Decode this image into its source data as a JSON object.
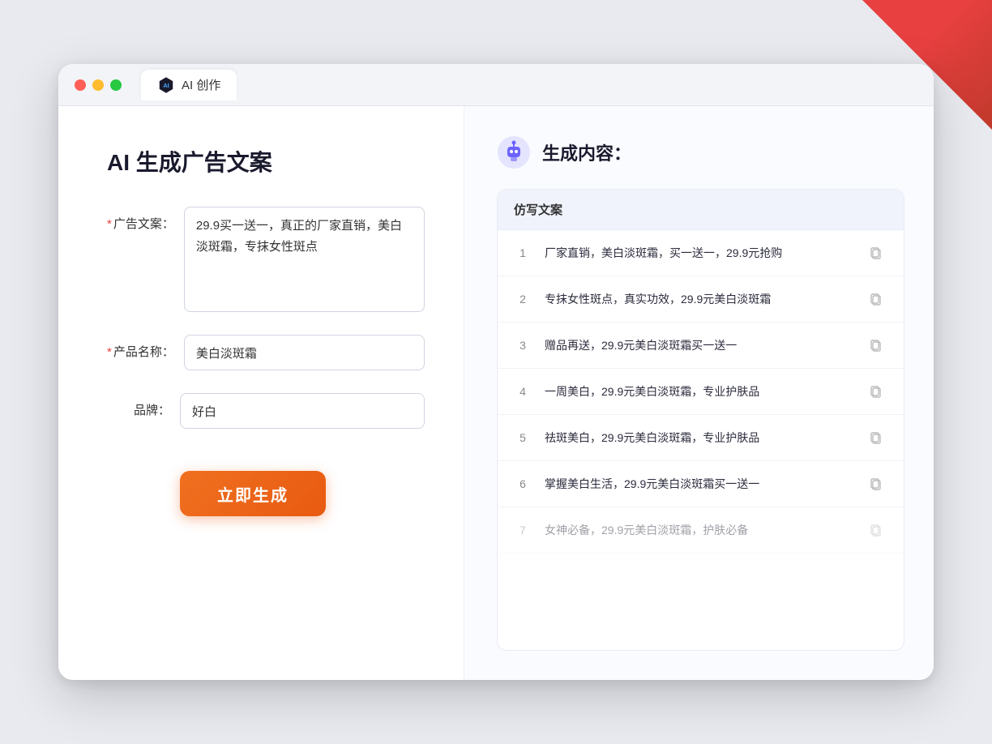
{
  "window": {
    "tab_label": "AI 创作"
  },
  "left_panel": {
    "title": "AI 生成广告文案",
    "form": {
      "ad_copy_label": "广告文案：",
      "ad_copy_required": "*",
      "ad_copy_value": "29.9买一送一，真正的厂家直销，美白淡斑霜，专抹女性斑点",
      "product_name_label": "产品名称：",
      "product_name_required": "*",
      "product_name_value": "美白淡斑霜",
      "brand_label": "品牌：",
      "brand_value": "好白"
    },
    "generate_button": "立即生成"
  },
  "right_panel": {
    "title": "生成内容：",
    "column_header": "仿写文案",
    "results": [
      {
        "num": "1",
        "text": "厂家直销，美白淡斑霜，买一送一，29.9元抢购",
        "faded": false
      },
      {
        "num": "2",
        "text": "专抹女性斑点，真实功效，29.9元美白淡斑霜",
        "faded": false
      },
      {
        "num": "3",
        "text": "赠品再送，29.9元美白淡斑霜买一送一",
        "faded": false
      },
      {
        "num": "4",
        "text": "一周美白，29.9元美白淡斑霜，专业护肤品",
        "faded": false
      },
      {
        "num": "5",
        "text": "祛斑美白，29.9元美白淡斑霜，专业护肤品",
        "faded": false
      },
      {
        "num": "6",
        "text": "掌握美白生活，29.9元美白淡斑霜买一送一",
        "faded": false
      },
      {
        "num": "7",
        "text": "女神必备，29.9元美白淡斑霜，护肤必备",
        "faded": true
      }
    ]
  }
}
